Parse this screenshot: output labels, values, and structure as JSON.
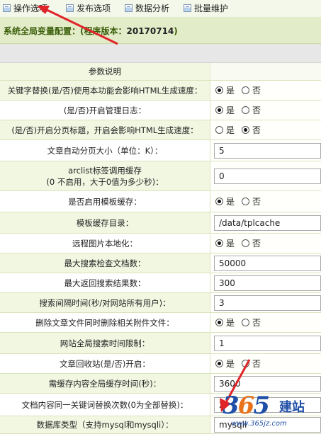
{
  "tabs": [
    {
      "label": "操作选项",
      "icon": "list-icon"
    },
    {
      "label": "发布选项",
      "icon": "list-icon"
    },
    {
      "label": "数据分析",
      "icon": "list-icon"
    },
    {
      "label": "批量维护",
      "icon": "list-icon"
    }
  ],
  "header": {
    "title_prefix": "系统全局变量配置：(程序版本：",
    "version": "20170714",
    "title_suffix": ")"
  },
  "table": {
    "header_label": "参数说明",
    "radio_yes": "是",
    "radio_no": "否",
    "rows": [
      {
        "label": "关键字替换(是/否)使用本功能会影响HTML生成速度：",
        "type": "radio",
        "value": "是"
      },
      {
        "label": "(是/否)开启管理日志：",
        "type": "radio",
        "value": "是"
      },
      {
        "label": "(是/否)开启分页标题，开启会影响HTML生成速度：",
        "type": "radio",
        "value": "否"
      },
      {
        "label": "文章自动分页大小（单位：K）：",
        "type": "text",
        "value": "5"
      },
      {
        "label": "arclist标签调用缓存",
        "label2": "(0 不启用，大于0值为多少秒)：",
        "type": "text",
        "value": "0"
      },
      {
        "label": "是否启用模板缓存：",
        "type": "radio",
        "value": "是"
      },
      {
        "label": "模板缓存目录：",
        "type": "text",
        "value": "/data/tplcache"
      },
      {
        "label": "远程图片本地化：",
        "type": "radio",
        "value": "是"
      },
      {
        "label": "最大搜索检查文档数：",
        "type": "text",
        "value": "50000"
      },
      {
        "label": "最大返回搜索结果数：",
        "type": "text",
        "value": "300"
      },
      {
        "label": "搜索间隔时间(秒/对网站所有用户)：",
        "type": "text",
        "value": "3"
      },
      {
        "label": "删除文章文件同时删除相关附件文件：",
        "type": "radio",
        "value": "是"
      },
      {
        "label": "网站全局搜索时间限制：",
        "type": "text",
        "value": "1"
      },
      {
        "label": "文章回收站(是/否)开启：",
        "type": "radio",
        "value": "是"
      },
      {
        "label": "需缓存内容全局缓存时间(秒)：",
        "type": "text",
        "value": "3600"
      },
      {
        "label": "文档内容同一关键词替换次数(0为全部替换)：",
        "type": "text",
        "value": "2"
      },
      {
        "label": "数据库类型（支持mysql和mysqli）：",
        "type": "text",
        "value": "mysqli"
      }
    ]
  },
  "watermark": {
    "number_a": "3",
    "number_b": "6",
    "number_c": "5",
    "cn": "建站",
    "url": "www.365jz.com"
  },
  "colors": {
    "accent_arrow": "#e0242a",
    "title_green": "#3b5f0a",
    "brand_blue": "#1f4fa6",
    "brand_orange": "#e8731c"
  }
}
